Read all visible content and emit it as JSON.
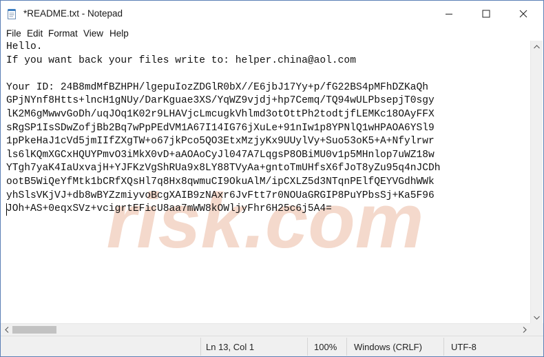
{
  "window": {
    "title": "*README.txt - Notepad",
    "icon": "notepad-icon",
    "accent_border": "#5b7fb5"
  },
  "controls": {
    "minimize_icon": "minimize-icon",
    "maximize_icon": "maximize-icon",
    "close_icon": "close-icon"
  },
  "menu": {
    "file": "File",
    "edit": "Edit",
    "format": "Format",
    "view": "View",
    "help": "Help"
  },
  "editor": {
    "lines": [
      "Hello.",
      "If you want back your files write to: helper.china@aol.com",
      "",
      "Your ID: 24B8mdMfBZHPH/lgepuIozZDGlR0bX//E6jbJ17Yy+p/fG22BS4pMFhDZKaQh",
      "GPjNYnf8Htts+lncH1gNUy/DarKguae3XS/YqWZ9vjdj+hp7Cemq/TQ94wULPbsepjT0sgy",
      "lK2M6gMwwvGoDh/uqJOq1K02r9LHAVjcLmcugkVhlmd3otOttPh2todtjfLEMKc18OAyFFX",
      "sRgSP1IsSDwZofjBb2Bq7wPpPEdVM1A67I14IG76jXuLe+91nIw1p8YPNlQ1wHPAOA6YSl9",
      "1pPkeHaJ1cVd5jmIIfZXgTW+o67jkPco5QO3EtxMzjyKx9UUylVy+Suo53oK5+A+Nfylrwr",
      "ls6lKQmXGCxHQUYPmvO3iMkX0vD+aAOAoCyJl047A7LqgsP8OBiMU0v1p5MHnlop7uWZ18w",
      "YTgh7yaK4IaUxvajH+YJFKzVgShRUa9x8LY88TVyAa+gntoTmUHfsX6fJoT8yZu95q4nJCDh",
      "ootB5WiQeYfMtk1bCRfXQsHl7q8Hx8qwmuCI9OkuAlM/ipCXLZ5d3NTqnPElfQEYVGdhWWk",
      "yhSlsVKjVJ+db8wBYZzmiyvoBcgXAIB9zNAxr6JvFtt7r0NOUaGRGIP8PuYPbsSj+Ka5F96",
      "JOh+AS+0eqxSVz+vcigrtEFicU8aa7mWW8kOWljyFhr6H25c6j5A4="
    ],
    "watermark": "risk.com",
    "watermark_color": "#f4d9cc"
  },
  "scrollbars": {
    "up_icon": "scroll-up-icon",
    "down_icon": "scroll-down-icon",
    "left_icon": "scroll-left-icon",
    "right_icon": "scroll-right-icon"
  },
  "status": {
    "position": "Ln 13, Col 1",
    "zoom": "100%",
    "line_ending": "Windows (CRLF)",
    "encoding": "UTF-8"
  }
}
